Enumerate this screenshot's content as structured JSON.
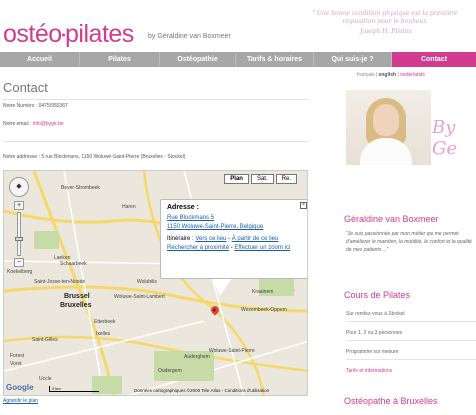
{
  "header": {
    "logo_left": "ostéo",
    "logo_dot": "•",
    "logo_right": "pilates",
    "logo_subtitle": "by Géraldine van Boxmeer",
    "quote": "\" Une bonne condition physique est la première requisition pour le bonheur.",
    "quote_author": "Joseph H. Pilates"
  },
  "nav": {
    "items": [
      {
        "label": "Accueil"
      },
      {
        "label": "Pilates"
      },
      {
        "label": "Ostéopathie"
      },
      {
        "label": "Tarifs & horaires"
      },
      {
        "label": "Qui suis-je ?"
      },
      {
        "label": "Contact"
      }
    ]
  },
  "content": {
    "title": "Contact",
    "numero_label": "Notre Numéro :",
    "numero_value": "0475/950367",
    "email_label": "Notre email :",
    "email_value": "info@byge.be",
    "address_label": "Notre addresse :",
    "address_value": "5 rue Blockmans, 1150 Woluwé-Saint-Pierre (Bruxelles - Stockel)",
    "map_link": "Agrandir le plan"
  },
  "map": {
    "pan": "◆",
    "zoom_in": "+",
    "zoom_out": "−",
    "types": [
      "Plan",
      "Sat.",
      "Re."
    ],
    "labels": {
      "city1": "Brussel",
      "city2": "Bruxelles",
      "l1": "Bever-Strombeek",
      "l2": "Laeken",
      "l3": "Haren",
      "l4": "Koekelberg",
      "l5": "Schaarbeek",
      "l6": "Saint-Josse-ten-Noode",
      "l7": "Wolubilis",
      "l8": "Etterbeek",
      "l9": "Woluwe-Saint-Lambert",
      "l10": "Wezembeek-Oppem",
      "l11": "Kraainem",
      "l12": "Auderghem",
      "l13": "Oudergem",
      "l14": "Woluwe-Saint-Pierre",
      "l15": "Ixelles",
      "l16": "Saint-Gilles",
      "l17": "Uccle",
      "l18": "Forest",
      "l19": "Vorst"
    },
    "google": "Google",
    "scale": "2 km",
    "copyright": "Données cartographiques ©2009 Tele Atlas - Conditions d'utilisation",
    "popup": {
      "title": "Adresse :",
      "addr1": "Rue Blockmans 5",
      "addr2": "1150 Woluwe-Saint-Pierre, Belgique",
      "itin_label": "Itinéraire :",
      "itin_link1": "Vers ce lieu",
      "itin_sep": " - ",
      "itin_link2": "À partir de ce lieu",
      "search": "Rechercher à proximité",
      "zoom": "Effectuer un zoom ici",
      "close": "×"
    }
  },
  "sidebar": {
    "lang_fr": "français",
    "lang_en": "english",
    "lang_nl": "nederlands",
    "lang_sep": " | ",
    "sign": "By Ge",
    "name": "Géraldine van Boxmeer",
    "quote": "\"Je suis passionnée par mon métier qui me permet d'améliorer le maintien, la mobilité, le confort et la qualité de mes patients ...\"",
    "section1": "Cours de Pilates",
    "items": [
      {
        "label": "Sur rendez-vous à Stockel"
      },
      {
        "label": "Pour 1, 2 ou 3 personnes"
      },
      {
        "label": "Programme sur mesure"
      }
    ],
    "tarifs_link": "Tarifs et informations",
    "section2": "Ostéopathe à Bruxelles"
  },
  "colors": {
    "accent": "#d23c8e",
    "nav_bg": "#a7a7a7",
    "link": "#1a5fa8",
    "map_bg": "#ece7dd"
  }
}
